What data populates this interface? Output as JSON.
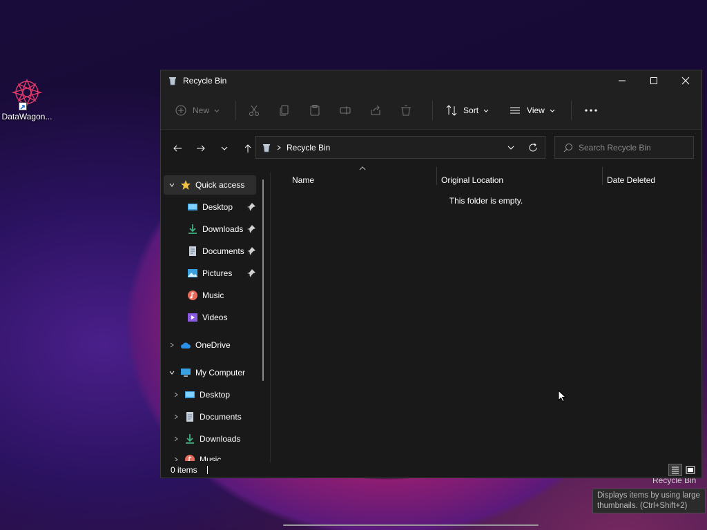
{
  "desktop": {
    "icons": [
      {
        "label": "DataWagon..."
      }
    ],
    "ghost_label": "Recycle Bin"
  },
  "window": {
    "title": "Recycle Bin",
    "toolbar": {
      "new_label": "New",
      "sort_label": "Sort",
      "view_label": "View"
    },
    "address": {
      "crumb": "Recycle Bin"
    },
    "search": {
      "placeholder": "Search Recycle Bin"
    },
    "nav": {
      "quick_access": "Quick access",
      "quick_items": [
        {
          "label": "Desktop",
          "pinned": true
        },
        {
          "label": "Downloads",
          "pinned": true
        },
        {
          "label": "Documents",
          "pinned": true
        },
        {
          "label": "Pictures",
          "pinned": true
        },
        {
          "label": "Music",
          "pinned": false
        },
        {
          "label": "Videos",
          "pinned": false
        }
      ],
      "onedrive": "OneDrive",
      "my_computer": "My Computer",
      "computer_items": [
        {
          "label": "Desktop"
        },
        {
          "label": "Documents"
        },
        {
          "label": "Downloads"
        },
        {
          "label": "Music"
        }
      ]
    },
    "columns": [
      "Name",
      "Original Location",
      "Date Deleted"
    ],
    "empty_message": "This folder is empty.",
    "status": {
      "items": "0 items"
    }
  },
  "tooltip": {
    "text": "Displays items by using large thumbnails. (Ctrl+Shift+2)"
  },
  "colors": {
    "folder_yellow": "#f5c243",
    "accent_blue": "#4cc2ff",
    "download_green": "#3fb27f"
  }
}
